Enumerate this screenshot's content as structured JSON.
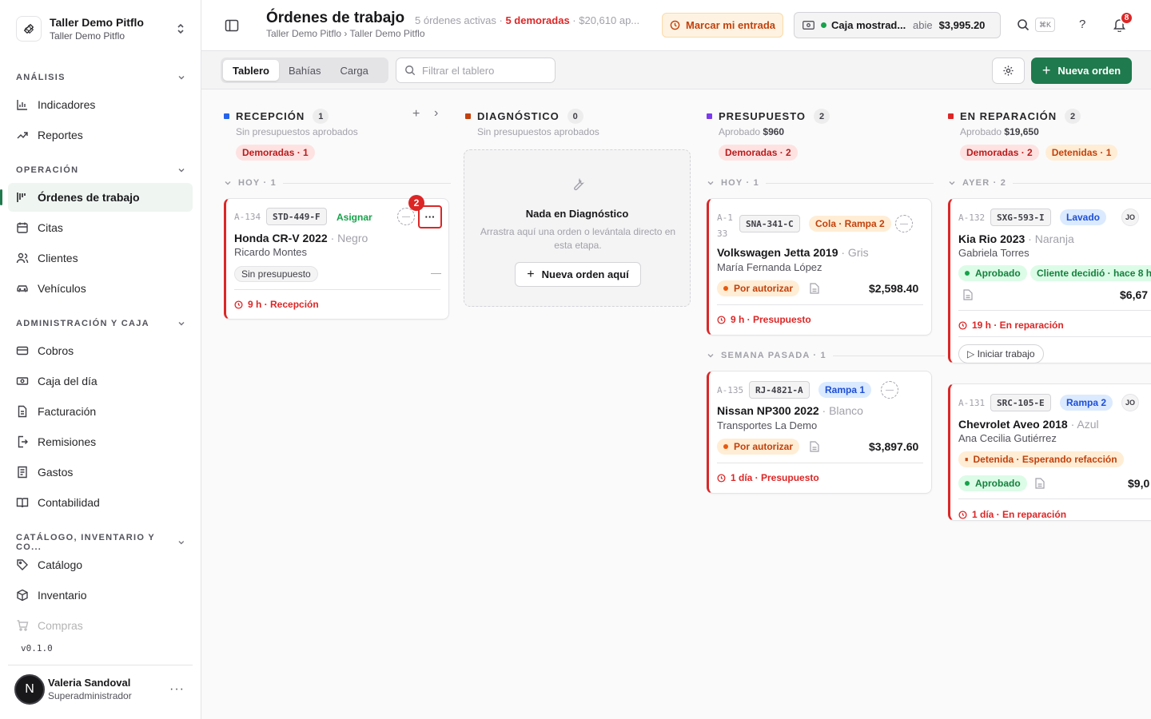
{
  "workspace": {
    "name": "Taller Demo Pitflo",
    "sub": "Taller Demo Pitflo"
  },
  "sidebar": {
    "sections": [
      {
        "label": "ANÁLISIS",
        "items": [
          "Indicadores",
          "Reportes"
        ]
      },
      {
        "label": "OPERACIÓN",
        "items": [
          "Órdenes de trabajo",
          "Citas",
          "Clientes",
          "Vehículos"
        ]
      },
      {
        "label": "ADMINISTRACIÓN Y CAJA",
        "items": [
          "Cobros",
          "Caja del día",
          "Facturación",
          "Remisiones",
          "Gastos",
          "Contabilidad"
        ]
      },
      {
        "label": "CATÁLOGO, INVENTARIO Y CO...",
        "items": [
          "Catálogo",
          "Inventario",
          "Compras"
        ]
      }
    ],
    "active": "Órdenes de trabajo",
    "version": "v0.1.0",
    "user": {
      "initial": "N",
      "name": "Valeria Sandoval",
      "role": "Superadministrador",
      "menu": "···"
    }
  },
  "header": {
    "title": "Órdenes de trabajo",
    "meta_active": "5 órdenes activas ·",
    "meta_late": "5 demoradas",
    "meta_rest": "· $20,610 ap...",
    "breadcrumb": "Taller Demo Pitflo › Taller Demo Pitflo",
    "entry_button": "Marcar mi entrada",
    "register": {
      "name": "Caja mostrad...",
      "status": "abie",
      "amount": "$3,995.20"
    },
    "shortcut": "⌘K",
    "help": "?",
    "notifications": "8"
  },
  "toolbar": {
    "tabs": [
      "Tablero",
      "Bahías",
      "Carga"
    ],
    "active_tab": "Tablero",
    "filter_placeholder": "Filtrar el tablero",
    "new_order": "Nueva orden",
    "new_order_plus": "+"
  },
  "columns": {
    "recepcion": {
      "title": "RECEPCIÓN",
      "count": "1",
      "sub": "Sin presupuestos aprobados",
      "pill": "Demoradas · 1",
      "add": "+",
      "next": "›"
    },
    "diagnostico": {
      "title": "DIAGNÓSTICO",
      "count": "0",
      "sub": "Sin presupuestos aprobados",
      "empty_title": "Nada en Diagnóstico",
      "empty_desc": "Arrastra aquí una orden o levántala directo en esta etapa.",
      "empty_button": "Nueva orden aquí",
      "empty_plus": "+"
    },
    "presupuesto": {
      "title": "PRESUPUESTO",
      "count": "2",
      "sub_label": "Aprobado",
      "sub_value": "$960",
      "pill": "Demoradas · 2"
    },
    "reparacion": {
      "title": "EN REPARACIÓN",
      "count": "2",
      "sub_label": "Aprobado",
      "sub_value": "$19,650",
      "pill": "Demoradas · 2",
      "pill2": "Detenidas · 1"
    }
  },
  "groups": {
    "hoy1": "HOY · 1",
    "hoy2": "HOY · 1",
    "semana": "SEMANA PASADA · 1",
    "ayer": "AYER · 2"
  },
  "cards": {
    "a134": {
      "id": "A-134",
      "plate": "STD-449-F",
      "assign": "Asignar",
      "vehicle": "Honda CR-V 2022",
      "color": "· Negro",
      "customer": "Ricardo Montes",
      "budget": "Sin presupuesto",
      "dash": "—",
      "time": "9 h · Recepción",
      "more": "···",
      "callout": "2"
    },
    "a133": {
      "id": "A-133",
      "plate": "SNA-341-C",
      "tag": "Cola · Rampa 2",
      "vehicle": "Volkswagen Jetta 2019",
      "color": "· Gris",
      "customer": "María Fernanda López",
      "status": "Por autorizar",
      "amount": "$2,598.40",
      "time": "9 h · Presupuesto"
    },
    "a135": {
      "id": "A-135",
      "plate": "RJ-4821-A",
      "tag": "Rampa 1",
      "vehicle": "Nissan NP300 2022",
      "color": "· Blanco",
      "customer": "Transportes La Demo",
      "status": "Por autorizar",
      "amount": "$3,897.60",
      "time": "1 día · Presupuesto"
    },
    "a132": {
      "id": "A-132",
      "plate": "SXG-593-I",
      "tag": "Lavado",
      "initials": "JO",
      "vehicle": "Kia Rio 2023",
      "color": "· Naranja",
      "customer": "Gabriela Torres",
      "status": "Aprobado",
      "decision": "Cliente decidió · hace 8 h",
      "amount": "$6,67",
      "time": "19 h · En reparación",
      "action": "▷ Iniciar trabajo"
    },
    "a131": {
      "id": "A-131",
      "plate": "SRC-105-E",
      "tag": "Rampa 2",
      "initials": "JO",
      "vehicle": "Chevrolet Aveo 2018",
      "color": "· Azul",
      "customer": "Ana Cecilia Gutiérrez",
      "hold": "Detenida · Esperando refacción",
      "hold_icon": "⏸",
      "status": "Aprobado",
      "amount": "$9,0",
      "time": "1 día · En reparación"
    }
  }
}
